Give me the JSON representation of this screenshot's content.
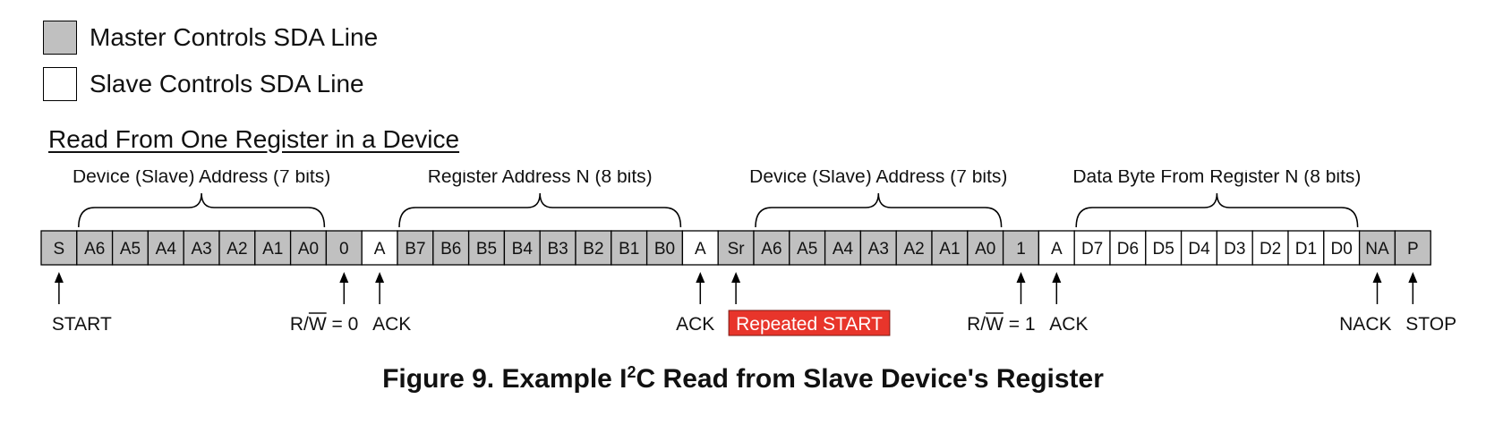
{
  "legend": {
    "master": {
      "label": "Master Controls SDA Line",
      "color": "#c0c0c0"
    },
    "slave": {
      "label": "Slave Controls SDA Line",
      "color": "#ffffff"
    }
  },
  "section_title": "Read From One Register in a Device",
  "colors": {
    "master": "#c0c0c0",
    "slave": "#ffffff",
    "highlight": "#e8352b",
    "stroke": "#000000"
  },
  "groups": [
    {
      "label": "Device (Slave) Address (7 bits)",
      "from": 1,
      "to": 7
    },
    {
      "label": "Register Address N (8 bits)",
      "from": 10,
      "to": 17
    },
    {
      "label": "Device (Slave) Address (7 bits)",
      "from": 20,
      "to": 26
    },
    {
      "label": "Data Byte From Register N (8 bits)",
      "from": 29,
      "to": 36
    }
  ],
  "bits": [
    {
      "text": "S",
      "owner": "master"
    },
    {
      "text": "A6",
      "owner": "master"
    },
    {
      "text": "A5",
      "owner": "master"
    },
    {
      "text": "A4",
      "owner": "master"
    },
    {
      "text": "A3",
      "owner": "master"
    },
    {
      "text": "A2",
      "owner": "master"
    },
    {
      "text": "A1",
      "owner": "master"
    },
    {
      "text": "A0",
      "owner": "master"
    },
    {
      "text": "0",
      "owner": "master"
    },
    {
      "text": "A",
      "owner": "slave"
    },
    {
      "text": "B7",
      "owner": "master"
    },
    {
      "text": "B6",
      "owner": "master"
    },
    {
      "text": "B5",
      "owner": "master"
    },
    {
      "text": "B4",
      "owner": "master"
    },
    {
      "text": "B3",
      "owner": "master"
    },
    {
      "text": "B2",
      "owner": "master"
    },
    {
      "text": "B1",
      "owner": "master"
    },
    {
      "text": "B0",
      "owner": "master"
    },
    {
      "text": "A",
      "owner": "slave"
    },
    {
      "text": "Sr",
      "owner": "master"
    },
    {
      "text": "A6",
      "owner": "master"
    },
    {
      "text": "A5",
      "owner": "master"
    },
    {
      "text": "A4",
      "owner": "master"
    },
    {
      "text": "A3",
      "owner": "master"
    },
    {
      "text": "A2",
      "owner": "master"
    },
    {
      "text": "A1",
      "owner": "master"
    },
    {
      "text": "A0",
      "owner": "master"
    },
    {
      "text": "1",
      "owner": "master"
    },
    {
      "text": "A",
      "owner": "slave"
    },
    {
      "text": "D7",
      "owner": "slave"
    },
    {
      "text": "D6",
      "owner": "slave"
    },
    {
      "text": "D5",
      "owner": "slave"
    },
    {
      "text": "D4",
      "owner": "slave"
    },
    {
      "text": "D3",
      "owner": "slave"
    },
    {
      "text": "D2",
      "owner": "slave"
    },
    {
      "text": "D1",
      "owner": "slave"
    },
    {
      "text": "D0",
      "owner": "slave"
    },
    {
      "text": "NA",
      "owner": "master"
    },
    {
      "text": "P",
      "owner": "master"
    }
  ],
  "markers": [
    {
      "bit": 0,
      "label": "START",
      "align": "start"
    },
    {
      "bit": 8,
      "label": "R/W = 0",
      "align": "end",
      "overline": "W"
    },
    {
      "bit": 9,
      "label": "ACK",
      "align": "start"
    },
    {
      "bit": 18,
      "label": "ACK",
      "align": "end"
    },
    {
      "bit": 19,
      "label": "Repeated START",
      "align": "start",
      "highlight": true
    },
    {
      "bit": 27,
      "label": "R/W = 1",
      "align": "end",
      "overline": "W"
    },
    {
      "bit": 28,
      "label": "ACK",
      "align": "start"
    },
    {
      "bit": 37,
      "label": "NACK",
      "align": "end"
    },
    {
      "bit": 38,
      "label": "STOP",
      "align": "start"
    }
  ],
  "caption": {
    "prefix": "Figure 9. Example I",
    "sup": "2",
    "suffix": "C Read from Slave Device's Register"
  }
}
